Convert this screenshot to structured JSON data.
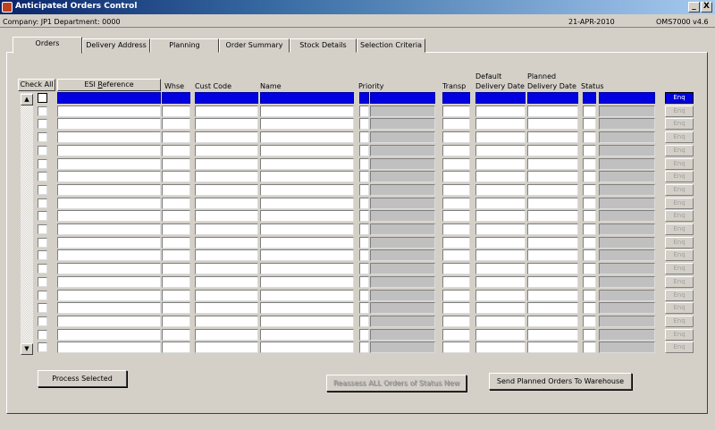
{
  "window": {
    "title": "Anticipated Orders Control",
    "minimize": "_",
    "close": "X"
  },
  "info": {
    "company": "Company:  JP1   Department:  0000",
    "date": "21-APR-2010",
    "version": "OMS7000  v4.6"
  },
  "tabs": [
    "Orders",
    "Delivery Address",
    "Planning",
    "Order Summary",
    "Stock Details",
    "Selection Criteria"
  ],
  "columns": {
    "check_all": "Check All",
    "esi_reference": "ESI Reference",
    "whse": "Whse",
    "cust_code": "Cust Code",
    "name": "Name",
    "priority": "Priority",
    "transp": "Transp",
    "default_delivery_1": "Default",
    "default_delivery_2": "Delivery Date",
    "planned_delivery_1": "Planned",
    "planned_delivery_2": "Delivery Date",
    "status": "Status"
  },
  "enq_label": "Enq",
  "row_count": 20,
  "selected_row": 0,
  "scroll": {
    "up": "▲",
    "down": "▼"
  },
  "buttons": {
    "process_selected": "Process Selected",
    "reassess": "Reassess ALL Orders of Status New",
    "send_planned": "Send Planned Orders To Warehouse"
  }
}
